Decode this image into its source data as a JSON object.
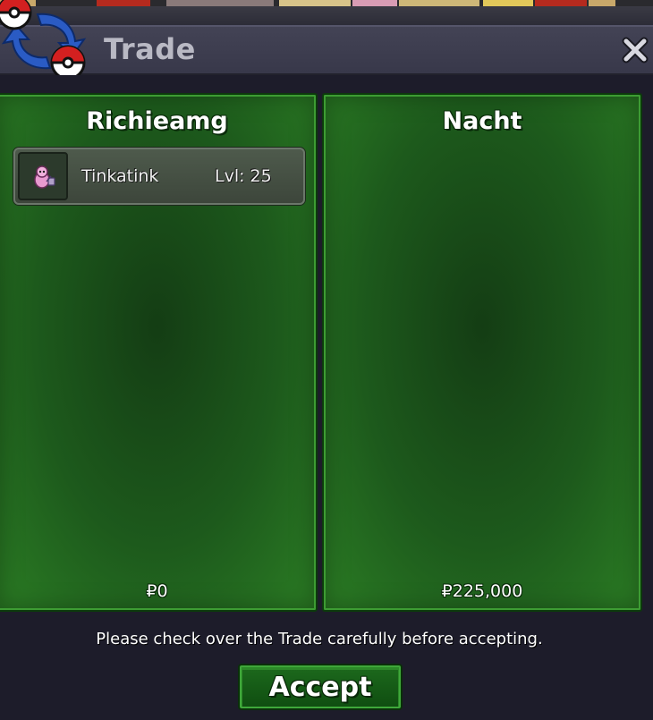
{
  "window": {
    "title": "Trade",
    "close_icon": "close-icon",
    "logo_icon": "trade-swap-logo-icon"
  },
  "offers": [
    {
      "trainer": "Richieamg",
      "items": [
        {
          "name": "Tinkatink",
          "level": "Lvl: 25",
          "sprite_icon": "tinkatink-sprite-icon"
        }
      ],
      "money": "₽0"
    },
    {
      "trainer": "Nacht",
      "items": [],
      "money": "₽225,000"
    }
  ],
  "footer": {
    "notice": "Please check over the Trade carefully before accepting.",
    "accept_label": "Accept"
  },
  "colors": {
    "panel_green": "#1d5a1c",
    "panel_border": "#3d9c33",
    "window_bg": "#1d1c2a",
    "titlebar": "#3d3d50",
    "pokeball_red": "#d32020",
    "arrow_blue": "#2a5bc4"
  }
}
